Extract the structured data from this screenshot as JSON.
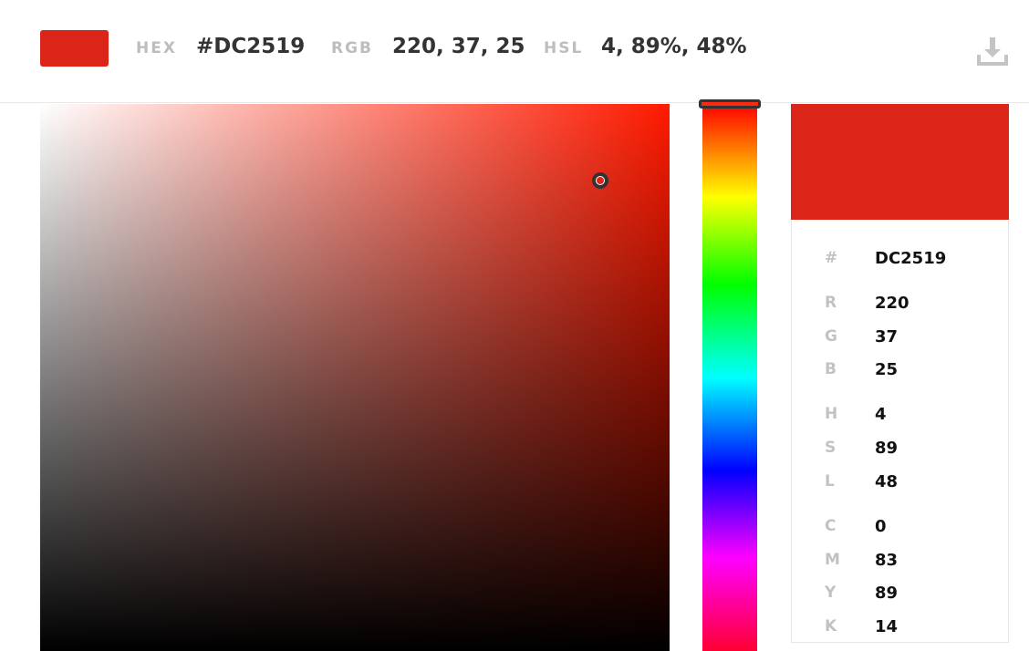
{
  "color": {
    "hex_value": "#DC2519",
    "rgb_value": "220, 37, 25",
    "hsl_value": "4, 89%, 48%",
    "swatch": "#DC2519",
    "hue_color": "#FF1A00"
  },
  "header": {
    "hex_label": "HEX",
    "rgb_label": "RGB",
    "hsl_label": "HSL",
    "download_icon": "download-icon"
  },
  "picker": {
    "saturation": 0.89,
    "value": 0.86,
    "hue_degrees": 4
  },
  "details": {
    "rows": [
      {
        "key": "#",
        "value": "DC2519"
      },
      {
        "key": "R",
        "value": "220"
      },
      {
        "key": "G",
        "value": "37"
      },
      {
        "key": "B",
        "value": "25"
      },
      {
        "key": "H",
        "value": "4"
      },
      {
        "key": "S",
        "value": "89"
      },
      {
        "key": "L",
        "value": "48"
      },
      {
        "key": "C",
        "value": "0"
      },
      {
        "key": "M",
        "value": "83"
      },
      {
        "key": "Y",
        "value": "89"
      },
      {
        "key": "K",
        "value": "14"
      }
    ]
  }
}
